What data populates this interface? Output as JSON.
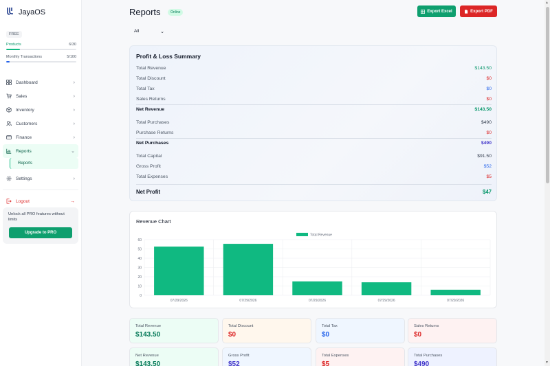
{
  "brand": {
    "name": "JayaOS"
  },
  "plan": {
    "badge": "FREE"
  },
  "usage": [
    {
      "label": "Products",
      "value": "6/30",
      "fraction": 0.2
    },
    {
      "label": "Monthly Transactions",
      "value": "5/100",
      "fraction": 0.05
    }
  ],
  "nav": {
    "items": [
      {
        "label": "Dashboard",
        "icon": "grid-icon"
      },
      {
        "label": "Sales",
        "icon": "cart-icon"
      },
      {
        "label": "Inventory",
        "icon": "box-icon"
      },
      {
        "label": "Customers",
        "icon": "users-icon"
      },
      {
        "label": "Finance",
        "icon": "wallet-icon"
      },
      {
        "label": "Reports",
        "icon": "report-icon"
      }
    ],
    "sub": "Reports",
    "settings": "Settings",
    "logout": "Logout"
  },
  "upsell": {
    "text": "Unlock all PRO features without limits",
    "button": "Upgrade to PRO"
  },
  "header": {
    "title": "Reports",
    "status": "Online",
    "excel": "Export Excel",
    "pdf": "Export PDF"
  },
  "filter": {
    "selected": "All"
  },
  "pl": {
    "title": "Profit & Loss Summary",
    "total_revenue": {
      "label": "Total Revenue",
      "value": "$143.50"
    },
    "total_discount": {
      "label": "Total Discount",
      "value": "$0"
    },
    "total_tax": {
      "label": "Total Tax",
      "value": "$0"
    },
    "sales_returns": {
      "label": "Sales Returns",
      "value": "$0"
    },
    "net_revenue": {
      "label": "Net Revenue",
      "value": "$143.50"
    },
    "total_purchases": {
      "label": "Total Purchases",
      "value": "$490"
    },
    "purchase_returns": {
      "label": "Purchase Returns",
      "value": "$0"
    },
    "net_purchases": {
      "label": "Net Purchases",
      "value": "$490"
    },
    "total_capital": {
      "label": "Total Capital",
      "value": "$91.50"
    },
    "gross_profit": {
      "label": "Gross Profit",
      "value": "$52"
    },
    "total_expenses": {
      "label": "Total Expenses",
      "value": "$5"
    },
    "net_profit": {
      "label": "Net Profit",
      "value": "$47"
    }
  },
  "chart": {
    "title": "Revenue Chart"
  },
  "chart_data": {
    "type": "bar",
    "title": "Revenue Chart",
    "legend": "top",
    "categories": [
      "07/29/2026",
      "07/29/2026",
      "07/29/2026",
      "07/29/2026",
      "07/29/2026"
    ],
    "series": [
      {
        "name": "Total Revenue",
        "values": [
          52.5,
          55.5,
          15,
          14,
          6
        ],
        "color": "#10b981"
      }
    ],
    "ylim": [
      0,
      60
    ],
    "yticks": [
      0,
      10,
      20,
      30,
      40,
      50,
      60
    ],
    "grid": true
  },
  "stats": [
    {
      "label": "Total Revenue",
      "value": "$143.50",
      "tone": "green"
    },
    {
      "label": "Total Discount",
      "value": "$0",
      "tone": "orange"
    },
    {
      "label": "Total Tax",
      "value": "$0",
      "tone": "blue"
    },
    {
      "label": "Sales Returns",
      "value": "$0",
      "tone": "pink"
    },
    {
      "label": "Net Revenue",
      "value": "$143.50",
      "tone": "green"
    },
    {
      "label": "Gross Profit",
      "value": "$52",
      "tone": "sky"
    },
    {
      "label": "Total Expenses",
      "value": "$5",
      "tone": "pink"
    },
    {
      "label": "Total Purchases",
      "value": "$490",
      "tone": "indigo"
    }
  ]
}
